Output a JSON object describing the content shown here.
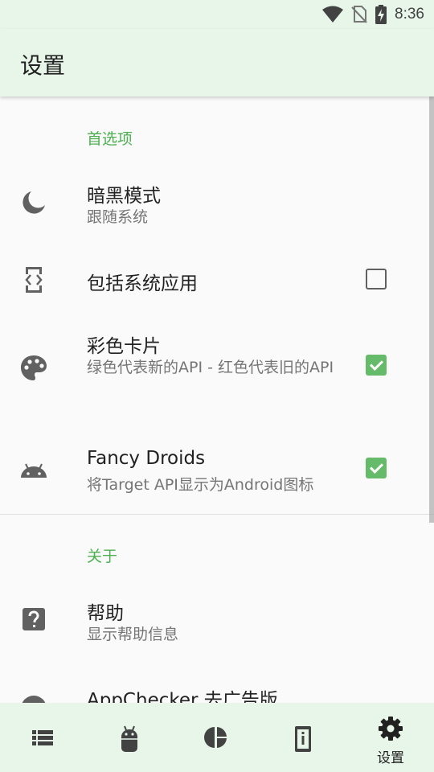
{
  "status_bar": {
    "time": "8:36",
    "icons": [
      "wifi-icon",
      "no-sim-icon",
      "battery-charging-icon"
    ]
  },
  "app_bar": {
    "title": "设置"
  },
  "sections": {
    "preferences": {
      "header": "首选项",
      "dark_mode": {
        "title": "暗黑模式",
        "summary": "跟随系统",
        "icon": "moon-icon"
      },
      "include_system_apps": {
        "title": "包括系统应用",
        "checked": false,
        "icon": "system-app-icon"
      },
      "colorful_cards": {
        "title": "彩色卡片",
        "summary": "绿色代表新的API - 红色代表旧的API",
        "checked": true,
        "icon": "palette-icon"
      },
      "fancy_droids": {
        "title": "Fancy Droids",
        "summary": "将Target API显示为Android图标",
        "checked": true,
        "icon": "android-icon"
      }
    },
    "about": {
      "header": "关于",
      "help": {
        "title": "帮助",
        "summary": "显示帮助信息",
        "icon": "help-icon"
      },
      "ad_free": {
        "title": "AppChecker 去广告版",
        "icon": "info-icon"
      }
    }
  },
  "bottom_nav": {
    "items": [
      {
        "icon": "list-icon",
        "label": ""
      },
      {
        "icon": "android-icon",
        "label": ""
      },
      {
        "icon": "pie-chart-icon",
        "label": ""
      },
      {
        "icon": "device-info-icon",
        "label": ""
      },
      {
        "icon": "settings-icon",
        "label": "设置",
        "active": true
      }
    ]
  },
  "colors": {
    "accent": "#4caf50",
    "checkbox_checked": "#66bb6a",
    "bar_background": "#e8f5e9"
  }
}
